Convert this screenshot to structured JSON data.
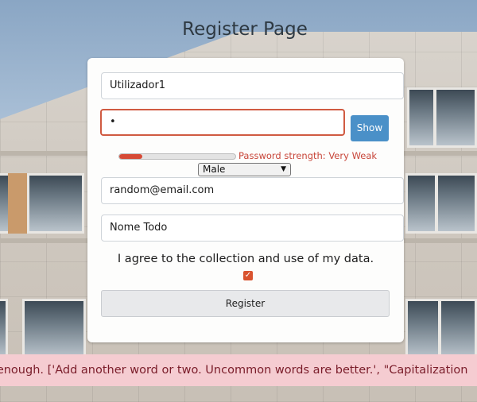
{
  "page": {
    "title": "Register Page"
  },
  "form": {
    "username_value": "Utilizador1",
    "password_value": "•",
    "show_label": "Show",
    "strength_text": "Password strength: Very Weak",
    "strength_fraction": 0.2,
    "gender_selected": "Male",
    "email_value": "random@email.com",
    "name_value": "Nome Todo",
    "agree_text": "I agree to the collection and use of my data.",
    "agree_checked": true,
    "register_label": "Register"
  },
  "alert": {
    "text": "g enough. ['Add another word or two. Uncommon words are better.', \"Capitalization"
  },
  "icons": {
    "checkbox": "check-icon",
    "select_chevron": "chevron-down-icon"
  },
  "colors": {
    "accent_button": "#4a90c8",
    "error": "#c8463a",
    "alert_bg": "#f5ccd1",
    "checkbox": "#d9532f"
  }
}
